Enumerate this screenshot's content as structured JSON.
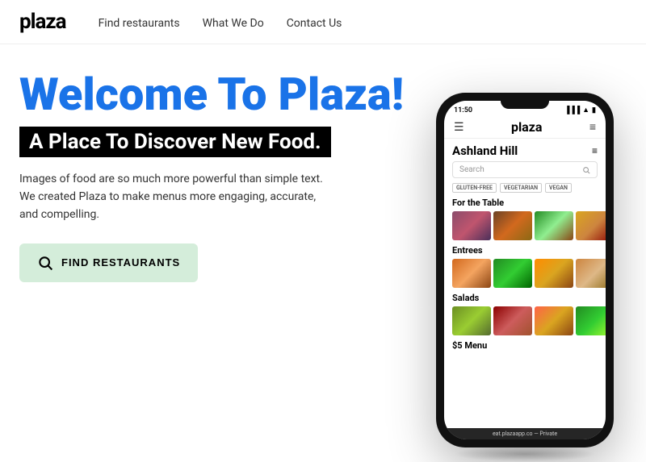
{
  "navbar": {
    "logo": "plaza",
    "links": [
      {
        "label": "Find restaurants",
        "href": "#"
      },
      {
        "label": "What We Do",
        "href": "#"
      },
      {
        "label": "Contact Us",
        "href": "#"
      }
    ]
  },
  "hero": {
    "title": "Welcome To Plaza!",
    "subtitle": "A Place To Discover New Food.",
    "description": "Images of food are so much more powerful than simple text. We created Plaza to make menus more engaging, accurate, and compelling.",
    "cta_label": "FIND RESTAURANTS"
  },
  "phone": {
    "status_time": "11:50",
    "app_logo": "plaza",
    "restaurant": "Ashland Hill",
    "search_placeholder": "Search",
    "tags": [
      "GLUTEN-FREE",
      "VEGETARIAN",
      "VEGAN"
    ],
    "sections": [
      {
        "title": "For the Table",
        "images": [
          "berry",
          "bowl",
          "salad",
          "pasta"
        ]
      },
      {
        "title": "Entrees",
        "images": [
          "fried",
          "green",
          "curry",
          "noodle"
        ]
      },
      {
        "title": "Salads",
        "images": [
          "wrap",
          "steak",
          "pizza",
          "avocado"
        ]
      },
      {
        "title": "$5 Menu",
        "images": []
      }
    ],
    "footer": "eat.plazaapp.co — Private"
  }
}
